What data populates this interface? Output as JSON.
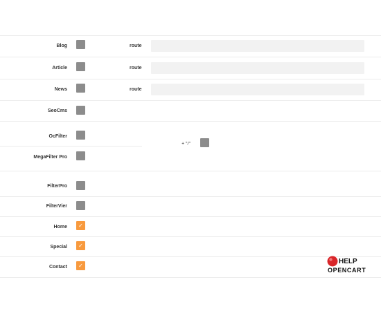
{
  "rows": [
    {
      "label": "Blog",
      "checked": false,
      "route_label": "route",
      "route_value": ""
    },
    {
      "label": "Article",
      "checked": false,
      "route_label": "route",
      "route_value": ""
    },
    {
      "label": "News",
      "checked": false,
      "route_label": "route",
      "route_value": ""
    },
    {
      "label": "SeoCms",
      "checked": false
    },
    {
      "label": "OcFilter",
      "checked": false
    },
    {
      "label": "MegaFilter Pro",
      "checked": false
    },
    {
      "label": "FilterPro",
      "checked": false
    },
    {
      "label": "FilterVier",
      "checked": false
    },
    {
      "label": "Home",
      "checked": true
    },
    {
      "label": "Special",
      "checked": true
    },
    {
      "label": "Contact",
      "checked": true
    }
  ],
  "separator": {
    "label": "+ \"/\"",
    "checked": false
  },
  "logo": {
    "line1": "HELP",
    "line2": "OPENCART"
  },
  "colors": {
    "checked": "#f89a3e",
    "unchecked": "#8c8c8c",
    "input_bg": "#f2f2f2",
    "divider": "#ececec",
    "logo_red": "#d9262a"
  }
}
